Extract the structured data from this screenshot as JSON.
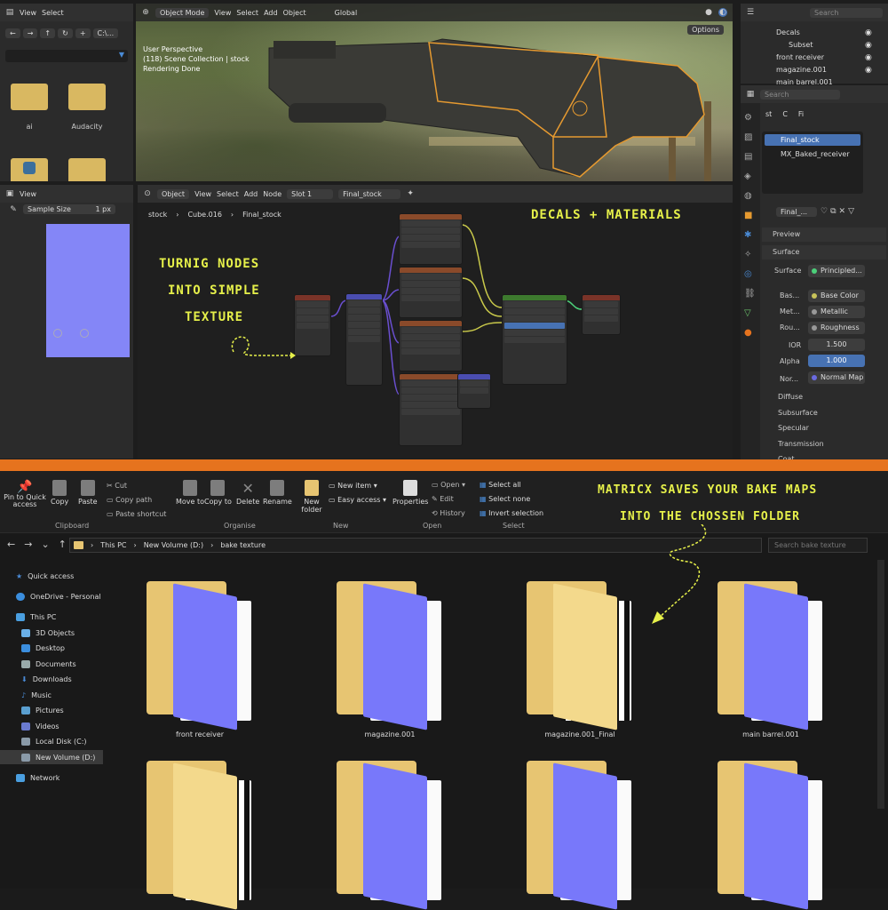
{
  "file_browser": {
    "menu_view": "View",
    "menu_select": "Select",
    "path": "C:\\...",
    "folders": [
      {
        "name": "ai"
      },
      {
        "name": "Audacity"
      },
      {
        "name": ""
      },
      {
        "name": ""
      }
    ]
  },
  "viewport": {
    "mode": "Object Mode",
    "menus": [
      "View",
      "Select",
      "Add",
      "Object"
    ],
    "transform": "Global",
    "options": "Options",
    "info_line1": "User Perspective",
    "info_line2": "(118) Scene Collection | stock",
    "info_line3": "Rendering Done"
  },
  "outliner": {
    "search_placeholder": "Search",
    "items": [
      "Decals",
      "Subset",
      "front receiver",
      "magazine.001",
      "main barrel.001"
    ]
  },
  "image_editor": {
    "menu_view": "View",
    "sample_size_label": "Sample Size",
    "sample_size_value": "1 px"
  },
  "node_editor": {
    "mode": "Object",
    "menus": [
      "View",
      "Select",
      "Add",
      "Node"
    ],
    "slot": "Slot 1",
    "material": "Final_stock",
    "breadcrumb": [
      "stock",
      "Cube.016",
      "Final_stock"
    ]
  },
  "properties": {
    "search_placeholder": "Search",
    "tab_labels": [
      "st",
      "C",
      "Fi"
    ],
    "slots": [
      "Final_stock",
      "MX_Baked_receiver"
    ],
    "material_field": "Final_...",
    "preview": "Preview",
    "surface_panel": "Surface",
    "surface_label": "Surface",
    "surface_value": "Principled...",
    "rows": [
      {
        "label": "Bas...",
        "value": "Base Color"
      },
      {
        "label": "Met...",
        "value": "Metallic"
      },
      {
        "label": "Rou...",
        "value": "Roughness"
      }
    ],
    "ior_label": "IOR",
    "ior_value": "1.500",
    "alpha_label": "Alpha",
    "alpha_value": "1.000",
    "normal_label": "Nor...",
    "normal_value": "Normal Map",
    "sections": [
      "Diffuse",
      "Subsurface",
      "Specular",
      "Transmission",
      "Coat"
    ]
  },
  "annotations": {
    "decals": "DECALS + MATERIALS",
    "turning1": "TURNIG NODES",
    "turning2": "INTO SIMPLE",
    "turning3": "TEXTURE",
    "matricx1": "MATRICX SAVES YOUR BAKE MAPS",
    "matricx2": "INTO THE CHOSSEN FOLDER"
  },
  "ribbon": {
    "groups": [
      "Clipboard",
      "Organise",
      "New",
      "Open",
      "Select"
    ],
    "pin": "Pin to Quick access",
    "copy": "Copy",
    "paste": "Paste",
    "cut": "Cut",
    "copy_path": "Copy path",
    "paste_shortcut": "Paste shortcut",
    "move_to": "Move to",
    "copy_to": "Copy to",
    "delete": "Delete",
    "rename": "Rename",
    "new_folder": "New folder",
    "new_item": "New item",
    "easy_access": "Easy access",
    "properties": "Properties",
    "open": "Open",
    "edit": "Edit",
    "history": "History",
    "select_all": "Select all",
    "select_none": "Select none",
    "invert_selection": "Invert selection"
  },
  "address": {
    "parts": [
      "This PC",
      "New Volume (D:)",
      "bake texture"
    ],
    "search_placeholder": "Search bake texture"
  },
  "nav": [
    "Quick access",
    "OneDrive - Personal",
    "This PC",
    "3D Objects",
    "Desktop",
    "Documents",
    "Downloads",
    "Music",
    "Pictures",
    "Videos",
    "Local Disk (C:)",
    "New Volume (D:)",
    "Network"
  ],
  "folders": [
    {
      "name": "front receiver"
    },
    {
      "name": "magazine.001"
    },
    {
      "name": "magazine.001_Final"
    },
    {
      "name": "main barrel.001"
    },
    {
      "name": ""
    },
    {
      "name": ""
    },
    {
      "name": ""
    },
    {
      "name": ""
    }
  ],
  "colors": {
    "annotation": "#e6f04a",
    "divider": "#e6731e",
    "accent": "#4772b3",
    "folder_back": "#e7c572",
    "folder_front": "#f3d98c",
    "folder_doc": "#7878fa"
  }
}
